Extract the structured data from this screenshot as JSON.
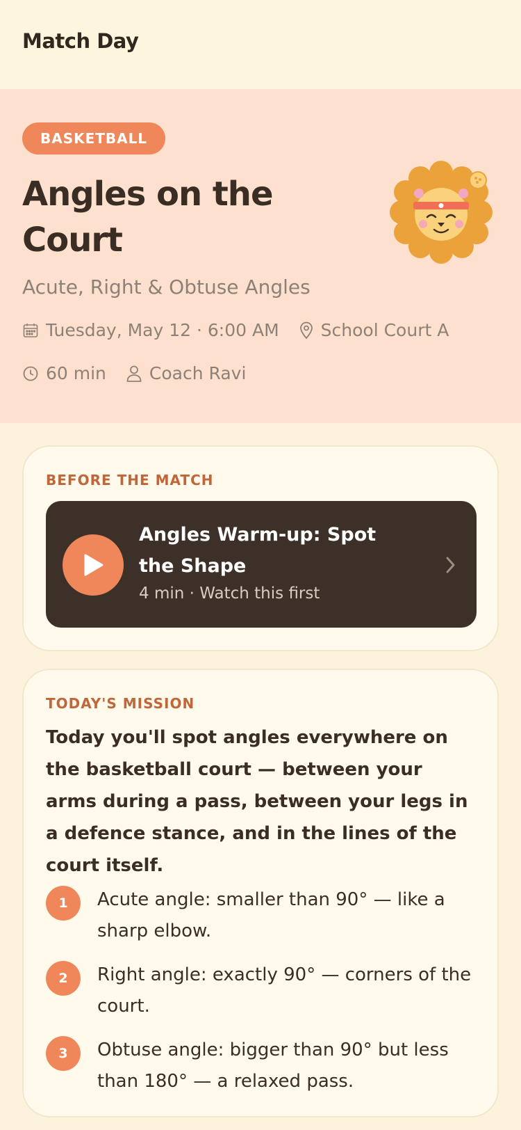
{
  "app": {
    "title": "Match Day"
  },
  "hero": {
    "sport_tag": "BASKETBALL",
    "title": "Angles on the Court",
    "subtitle": "Acute, Right & Obtuse Angles",
    "date": "Tuesday, May 12 · 6:00 AM",
    "location": "School Court A",
    "duration": "60 min",
    "coach": "Coach Ravi",
    "mascot": "lion-mascot-with-headband"
  },
  "before_match": {
    "label": "BEFORE THE MATCH",
    "video_title": "Angles Warm-up: Spot the Shape",
    "video_meta": "4 min · Watch this first"
  },
  "mission": {
    "label": "TODAY'S MISSION",
    "intro": "Today you'll spot angles everywhere on the basketball court — between your arms during a pass, between your legs in a defence stance, and in the lines of the court itself.",
    "steps": [
      {
        "num": "1",
        "text": "Acute angle: smaller than 90° — like a sharp elbow."
      },
      {
        "num": "2",
        "text": "Right angle: exactly 90° — corners of the court."
      },
      {
        "num": "3",
        "text": "Obtuse angle: bigger than 90° but less than 180° — a relaxed pass."
      }
    ]
  },
  "colors": {
    "accent": "#f0875a",
    "hero_bg": "#fde0cd",
    "page_bg": "#fdf3dd",
    "dark_card": "#3c3028",
    "label": "#c0663b"
  }
}
